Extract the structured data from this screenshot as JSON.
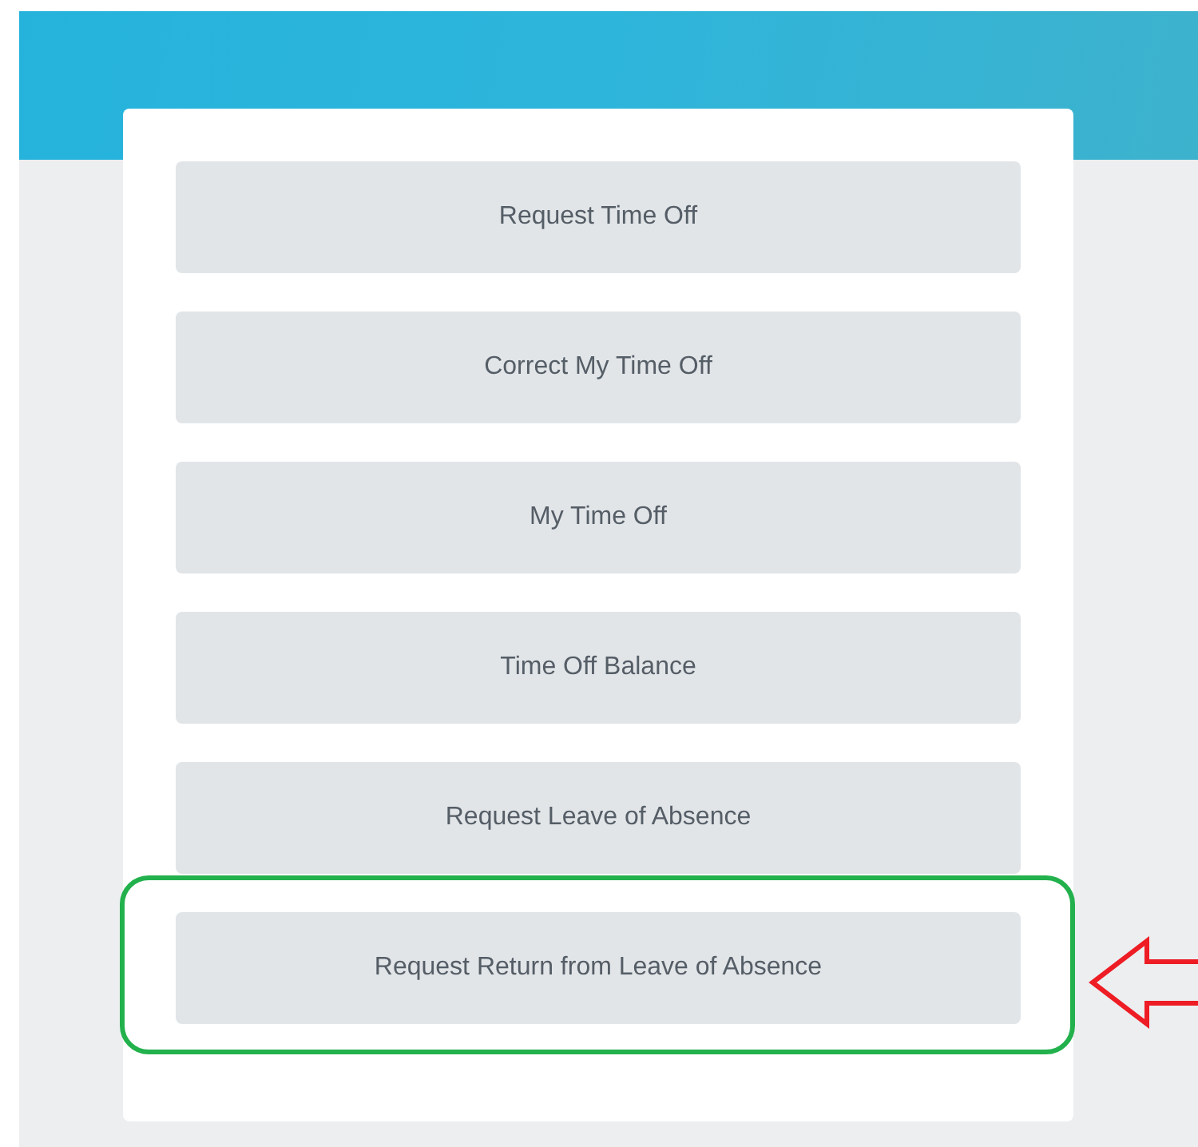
{
  "buttons": [
    {
      "label": "Request Time Off",
      "highlighted": false
    },
    {
      "label": "Correct My Time Off",
      "highlighted": false
    },
    {
      "label": "My Time Off",
      "highlighted": false
    },
    {
      "label": "Time Off Balance",
      "highlighted": false
    },
    {
      "label": "Request Leave of Absence",
      "highlighted": false
    },
    {
      "label": "Request Return from Leave of Absence",
      "highlighted": true
    }
  ]
}
